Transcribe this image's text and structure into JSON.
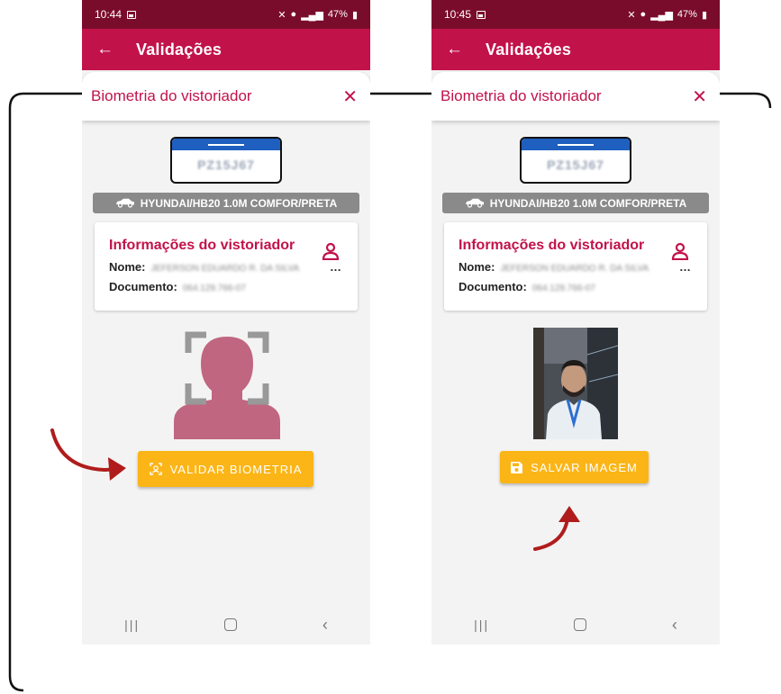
{
  "phones": [
    {
      "status_time": "10:44",
      "status_right": "47%",
      "appbar_title": "Validações",
      "modal_title": "Biometria do vistoriador",
      "plate_text": "PZ15J67",
      "vehicle": "HYUNDAI/HB20 1.0M COMFOR/PRETA",
      "info_title": "Informações do vistoriador",
      "name_label": "Nome:",
      "name_value": "JEFERSON EDUARDO R. DA SILVA",
      "doc_label": "Documento:",
      "doc_value": "064.129.766-07",
      "button_label": "VALIDAR BIOMETRIA"
    },
    {
      "status_time": "10:45",
      "status_right": "47%",
      "appbar_title": "Validações",
      "modal_title": "Biometria do vistoriador",
      "plate_text": "PZ15J67",
      "vehicle": "HYUNDAI/HB20 1.0M COMFOR/PRETA",
      "info_title": "Informações do vistoriador",
      "name_label": "Nome:",
      "name_value": "JEFERSON EDUARDO R. DA SILVA",
      "doc_label": "Documento:",
      "doc_value": "064.129.766-07",
      "button_label": "SALVAR IMAGEM"
    }
  ],
  "icons": {
    "back": "arrow-left-icon",
    "close": "close-icon",
    "car": "car-icon",
    "user": "user-icon",
    "face_scan": "face-scan-icon",
    "save": "floppy-disk-icon"
  },
  "colors": {
    "primary": "#c2124a",
    "status_bar": "#7a0c2b",
    "button": "#fbb517",
    "annotation_arrow": "#b01c1c",
    "silhouette": "#c06680"
  }
}
